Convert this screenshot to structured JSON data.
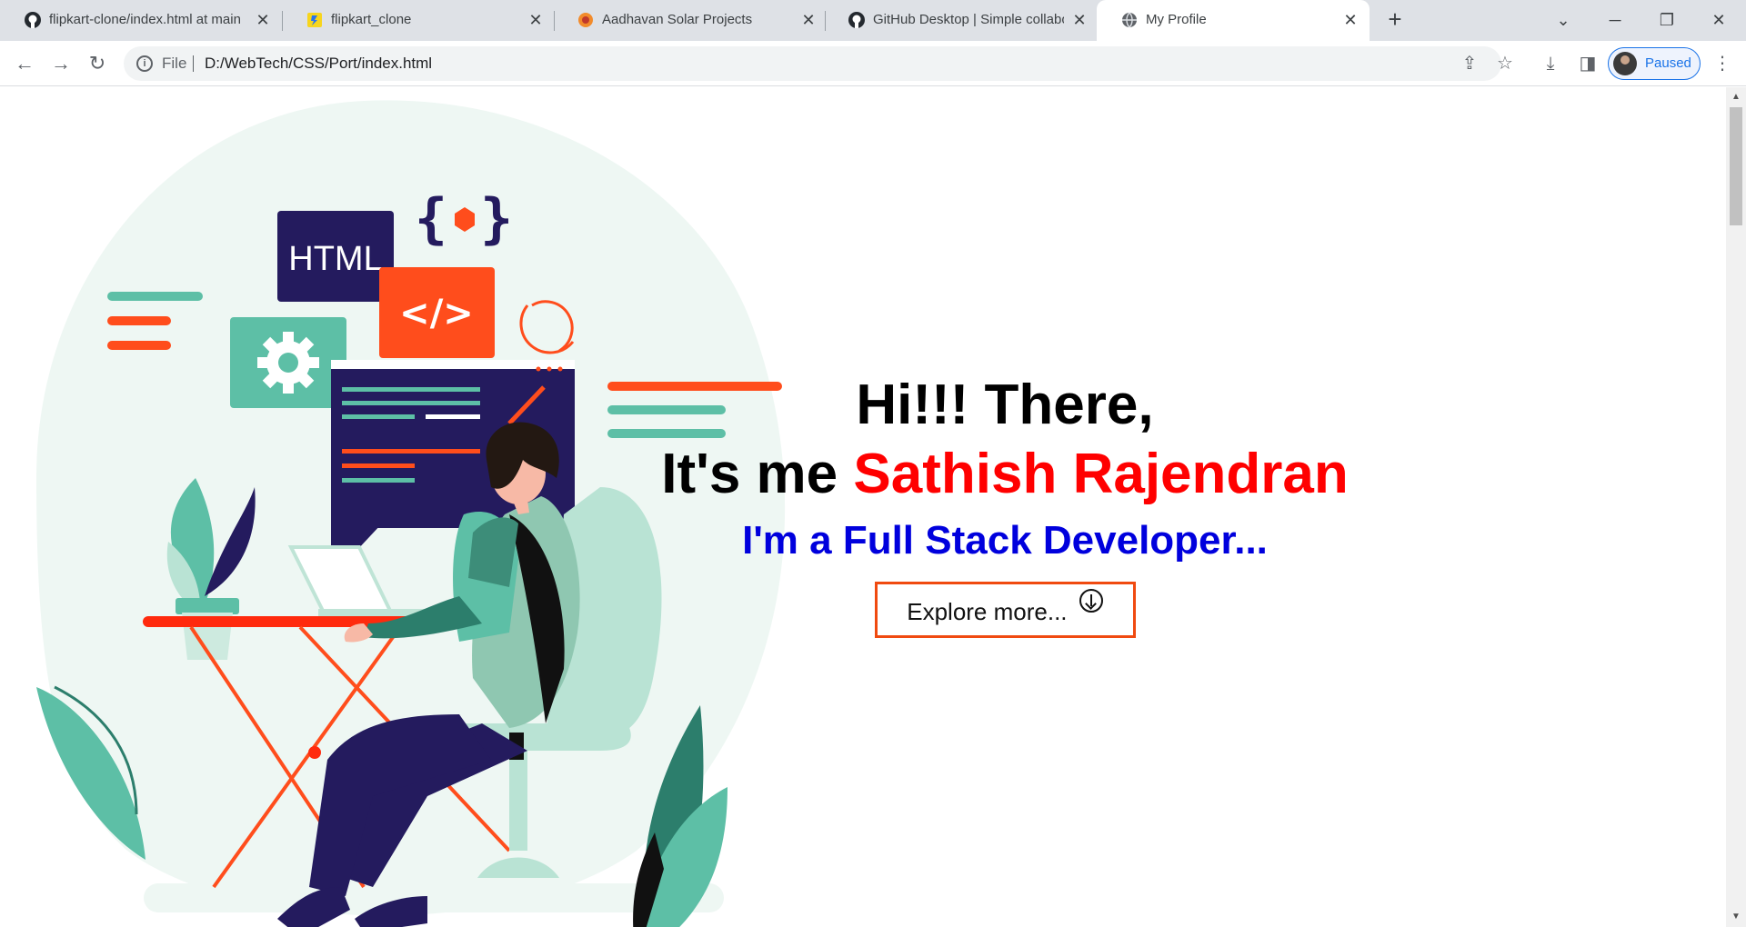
{
  "browser": {
    "tabs": [
      {
        "title": "flipkart-clone/index.html at main",
        "icon": "github-icon"
      },
      {
        "title": "flipkart_clone",
        "icon": "flipkart-icon"
      },
      {
        "title": "Aadhavan Solar Projects",
        "icon": "solar-icon"
      },
      {
        "title": "GitHub Desktop | Simple collabo",
        "icon": "github-icon"
      },
      {
        "title": "My Profile",
        "icon": "globe-icon",
        "active": true
      }
    ],
    "new_tab_symbol": "+",
    "address": {
      "scheme": "File",
      "url": "D:/WebTech/CSS/Port/index.html"
    },
    "profile_status": "Paused"
  },
  "hero": {
    "greeting": "Hi!!! There,",
    "intro_prefix": "It's me ",
    "name": "Sathish Rajendran",
    "role": "I'm a Full Stack Developer...",
    "button_label": "Explore more..."
  },
  "illustration": {
    "code_badge": "HTML",
    "code_tag": "</>",
    "braces": "{ }",
    "colors": {
      "teal": "#5dbfa6",
      "orange": "#ff4d1c",
      "navy": "#241b5e",
      "mint": "#eef7f3"
    }
  },
  "colors": {
    "name": "#ff0000",
    "role": "#0000dd",
    "button_border": "#f04a10"
  }
}
